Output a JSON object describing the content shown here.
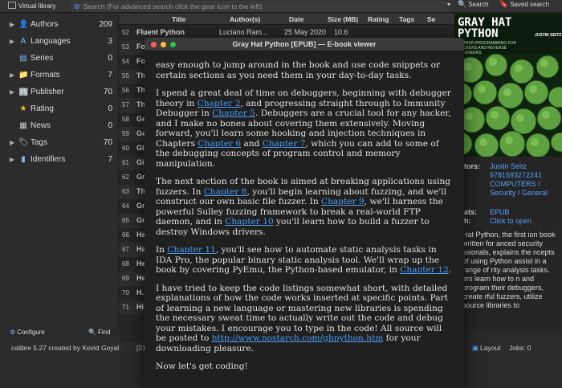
{
  "topbar": {
    "virtual_library": "Virtual library",
    "search_placeholder": "Search (For advanced search click the gear icon to the left)",
    "search_button": "Search",
    "saved_search_button": "Saved search"
  },
  "tag_browser": {
    "items": [
      {
        "label": "Authors",
        "count": "209",
        "icon": "person-icon"
      },
      {
        "label": "Languages",
        "count": "3",
        "icon": "languages-icon"
      },
      {
        "label": "Series",
        "count": "0",
        "icon": "series-icon"
      },
      {
        "label": "Formats",
        "count": "7",
        "icon": "formats-icon"
      },
      {
        "label": "Publisher",
        "count": "70",
        "icon": "publisher-icon"
      },
      {
        "label": "Rating",
        "count": "0",
        "icon": "star-icon"
      },
      {
        "label": "News",
        "count": "0",
        "icon": "news-icon"
      },
      {
        "label": "Tags",
        "count": "70",
        "icon": "tag-icon"
      },
      {
        "label": "Identifiers",
        "count": "7",
        "icon": "identifiers-icon"
      }
    ],
    "configure": "Configure",
    "find": "Find"
  },
  "book_list": {
    "headers": {
      "title": "Title",
      "authors": "Author(s)",
      "date": "Date",
      "size": "Size (MB)",
      "rating": "Rating",
      "tags": "Tags",
      "se": "Se"
    },
    "first_row": {
      "num": "52",
      "title": "Fluent Python",
      "author": "Luciano Ram...",
      "date": "25 May 2020",
      "size": "10.6"
    },
    "rows": [
      {
        "num": "53",
        "title": "Fo"
      },
      {
        "num": "54",
        "title": "Fo"
      },
      {
        "num": "55",
        "title": "Th"
      },
      {
        "num": "56",
        "title": "Th"
      },
      {
        "num": "57",
        "title": "Th"
      },
      {
        "num": "58",
        "title": "Ge"
      },
      {
        "num": "59",
        "title": "Ge"
      },
      {
        "num": "60",
        "title": "Gi"
      },
      {
        "num": "61",
        "title": "Gi"
      },
      {
        "num": "62",
        "title": "Gr"
      },
      {
        "num": "63",
        "title": "Th"
      },
      {
        "num": "64",
        "title": "Gr"
      },
      {
        "num": "65",
        "title": "Gr"
      },
      {
        "num": "66",
        "title": "Ha"
      },
      {
        "num": "67",
        "title": "Ha"
      },
      {
        "num": "68",
        "title": "He"
      },
      {
        "num": "69",
        "title": "He"
      },
      {
        "num": "70",
        "title": "H."
      },
      {
        "num": "71",
        "title": "Hi"
      }
    ]
  },
  "right_panel": {
    "cover": {
      "title_line1": "GRAY HAT",
      "title_line2": "PYTHON",
      "subtitle": "PYTHON PROGRAMMING FOR HACKERS AND REVERSE ENGINEERS",
      "author": "JUSTIN SEITZ"
    },
    "meta": {
      "authors_key": "tors:",
      "authors_val": "Justin Seitz",
      "isbn_val": "9781593272241",
      "tags_val": "COMPUTERS / Security / General",
      "formats_key": "ats:",
      "formats_val": "EPUB",
      "path_key": "h:",
      "path_val": "Click to open"
    },
    "description": "Hat Python, the first ion book written for anced security ssionals, explains the ncepts of using Python assist in a range of rity analysis tasks. ers learn how to n and program their debuggers, create rful fuzzers, utilize source libraries to"
  },
  "status_bar": {
    "app": "calibre 5.27 created by Kovid Goyal",
    "books": "[21",
    "layout": "Layout",
    "jobs": "Jobs: 0"
  },
  "viewer": {
    "title": "Gray Hat Python [EPUB] — E-book viewer",
    "p1": "easy enough to jump around in the book and use code snippets or certain sections as you need them in your day-to-day tasks.",
    "p2_a": "I spend a great deal of time on debuggers, beginning with debugger theory in ",
    "ch2": "Chapter 2",
    "p2_b": ", and progressing straight through to Immunity Debugger in ",
    "ch5": "Chapter 5",
    "p2_c": ". Debuggers are a crucial tool for any hacker, and I make no bones about covering them extensively. Moving forward, you'll learn some hooking and injection techniques in Chapters ",
    "ch6": "Chapter 6",
    "p2_d": " and ",
    "ch7": "Chapter 7",
    "p2_e": ", which you can add to some of the debugging concepts of program control and memory manipulation.",
    "p3_a": "The next section of the book is aimed at breaking applications using fuzzers. In ",
    "ch8": "Chapter 8",
    "p3_b": ", you'll begin learning about fuzzing, and we'll construct our own basic file fuzzer. In ",
    "ch9": "Chapter 9",
    "p3_c": ", we'll harness the powerful Sulley fuzzing framework to break a real-world FTP daemon, and in ",
    "ch10": "Chapter 10",
    "p3_d": " you'll learn how to build a fuzzer to destroy Windows drivers.",
    "p4_a": "In ",
    "ch11": "Chapter 11",
    "p4_b": ", you'll see how to automate static analysis tasks in IDA Pro, the popular binary static analysis tool. We'll wrap up the book by covering PyEmu, the Python-based emulator, in ",
    "ch12": "Chapter 12",
    "p4_c": ".",
    "p5_a": "I have tried to keep the code listings somewhat short, with detailed explanations of how the code works inserted at specific points. Part of learning a new language or mastering new libraries is spending the necessary sweat time to actually write out the code and debug your mistakes. I encourage you to type in the code! All source will be posted to ",
    "url": "http://www.nostarch.com/ghpython.htm",
    "p5_b": " for your downloading pleasure.",
    "p6": "Now let's get coding!"
  }
}
